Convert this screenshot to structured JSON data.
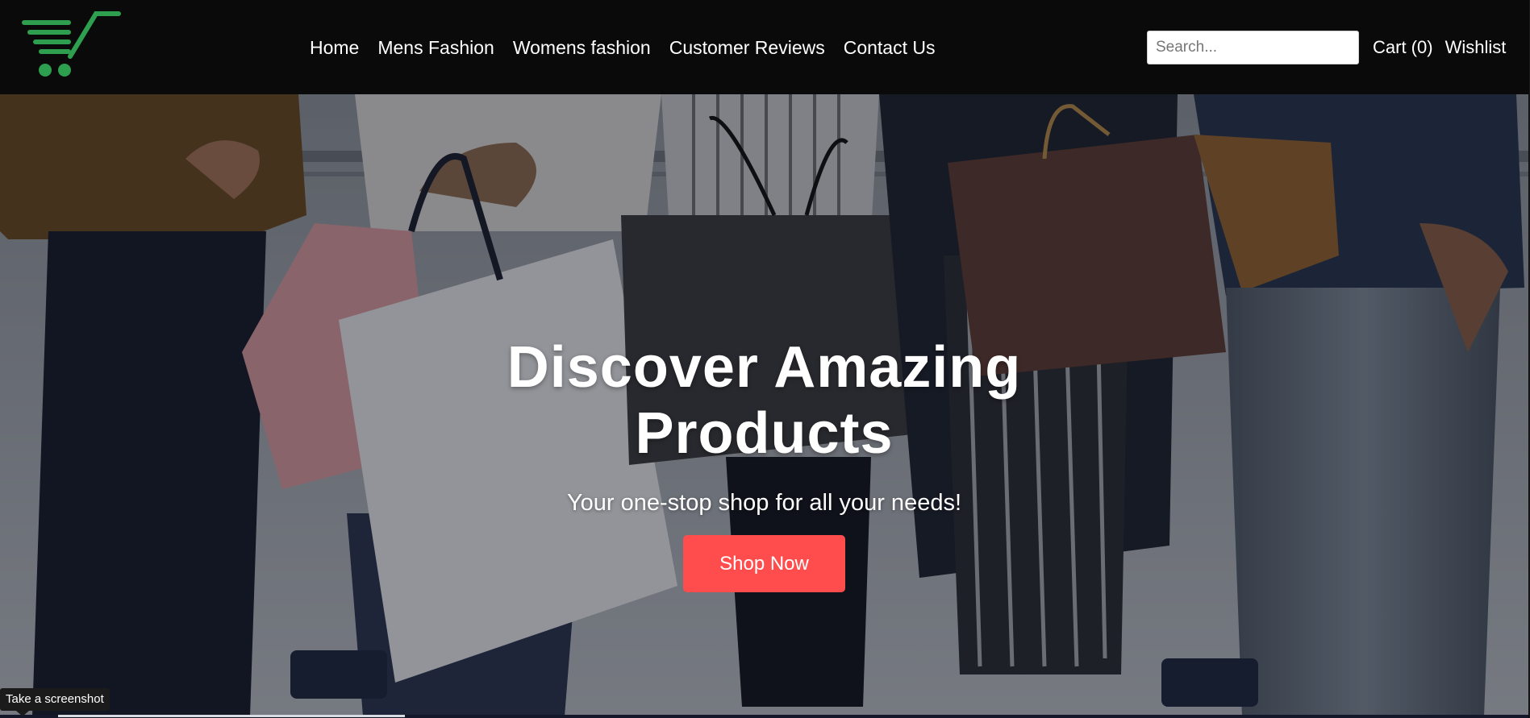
{
  "header": {
    "logo_icon": "shopping-cart-icon",
    "brand_color": "#2e9e4f",
    "nav": [
      {
        "label": "Home"
      },
      {
        "label": "Mens Fashion"
      },
      {
        "label": "Womens fashion"
      },
      {
        "label": "Customer Reviews"
      },
      {
        "label": "Contact Us"
      }
    ],
    "search": {
      "placeholder": "Search...",
      "value": ""
    },
    "cart_label": "Cart (0)",
    "wishlist_label": "Wishlist"
  },
  "hero": {
    "title": "Discover Amazing Products",
    "subtitle": "Your one-stop shop for all your needs!",
    "cta_label": "Shop Now",
    "cta_color": "#ff4c4c"
  },
  "tooltip": {
    "text": "Take a screenshot"
  }
}
